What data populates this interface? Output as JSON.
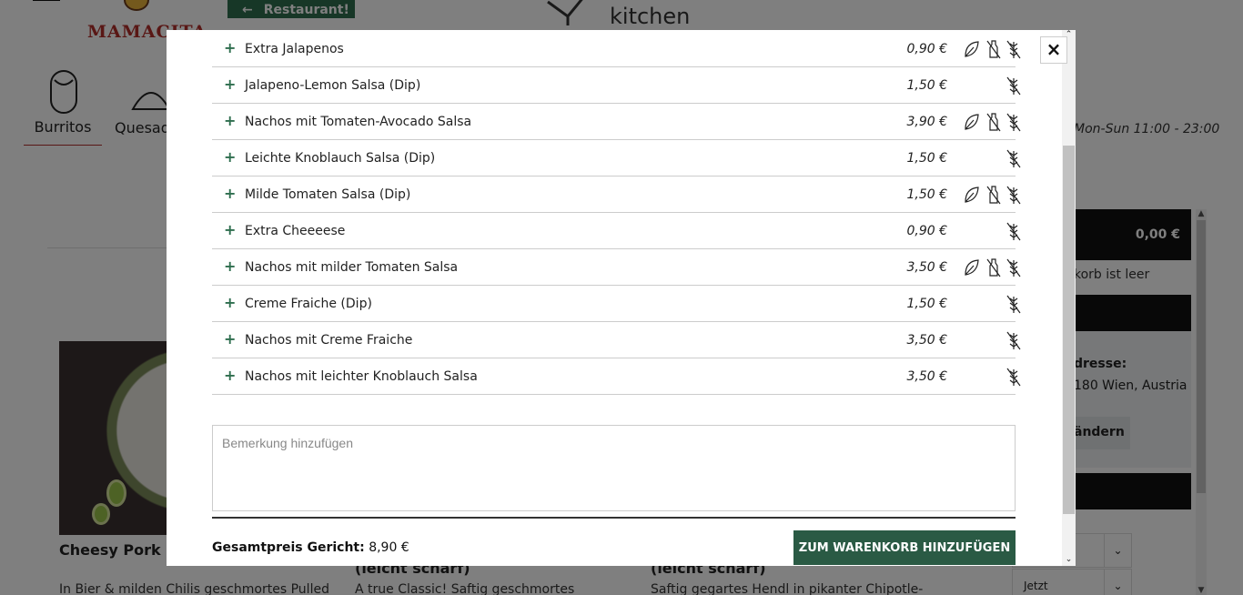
{
  "background": {
    "brand_name": "MAMACITA",
    "restaurant_button": "Restaurant!",
    "kitchen_logo_text": "kitchen",
    "categories": [
      {
        "label": "Burritos"
      },
      {
        "label": "Quesad"
      }
    ],
    "opening_hours": "Mon-Sun 11:00 - 23:00",
    "dishes": [
      {
        "title": "Cheesy Pork Bu",
        "desc": "In Bier & milden Chilis geschmortes Pulled"
      },
      {
        "title": "(leicht scharf)",
        "desc": "A true Classic! Saftig geschmortes"
      },
      {
        "title": "(leicht scharf)",
        "desc": "Saftig gegartes Hendl in pikanter Chipotle-"
      }
    ],
    "cart": {
      "total": "0,00 €",
      "empty_text": "korb ist leer",
      "tab_label": "H",
      "address_label": "dresse:",
      "address_value": "180 Wien, Austria",
      "change_button": "ändern",
      "select_1": "n",
      "select_2": "Jetzt"
    }
  },
  "modal": {
    "close_label": "×",
    "extras": [
      {
        "name": "Extra Jalapenos",
        "price": "0,90 €",
        "leaf": true,
        "bottle": true,
        "wheat": true
      },
      {
        "name": "Jalapeno-Lemon Salsa (Dip)",
        "price": "1,50 €",
        "leaf": false,
        "bottle": false,
        "wheat": true
      },
      {
        "name": "Nachos mit Tomaten-Avocado Salsa",
        "price": "3,90 €",
        "leaf": true,
        "bottle": true,
        "wheat": true
      },
      {
        "name": "Leichte Knoblauch Salsa (Dip)",
        "price": "1,50 €",
        "leaf": false,
        "bottle": false,
        "wheat": true
      },
      {
        "name": "Milde Tomaten Salsa (Dip)",
        "price": "1,50 €",
        "leaf": true,
        "bottle": true,
        "wheat": true
      },
      {
        "name": "Extra Cheeeese",
        "price": "0,90 €",
        "leaf": false,
        "bottle": false,
        "wheat": true
      },
      {
        "name": "Nachos mit milder Tomaten Salsa",
        "price": "3,50 €",
        "leaf": true,
        "bottle": true,
        "wheat": true
      },
      {
        "name": "Creme Fraiche (Dip)",
        "price": "1,50 €",
        "leaf": false,
        "bottle": false,
        "wheat": true
      },
      {
        "name": "Nachos mit Creme Fraiche",
        "price": "3,50 €",
        "leaf": false,
        "bottle": false,
        "wheat": true
      },
      {
        "name": "Nachos mit leichter Knoblauch Salsa",
        "price": "3,50 €",
        "leaf": false,
        "bottle": false,
        "wheat": true
      }
    ],
    "plus_symbol": "+",
    "remark_placeholder": "Bemerkung hinzufügen",
    "total_label": "Gesamtpreis Gericht:",
    "total_value": "8,90 €",
    "add_to_cart_button": "ZUM WARENKORB HINZUFÜGEN"
  },
  "colors": {
    "accent_green": "#2a5a44",
    "brand_red": "#b22f2a"
  }
}
